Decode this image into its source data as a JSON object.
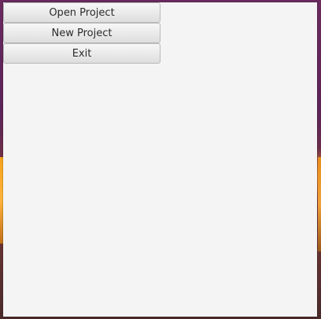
{
  "menu": {
    "buttons": [
      {
        "label": "Open Project"
      },
      {
        "label": "New Project"
      },
      {
        "label": "Exit"
      }
    ]
  },
  "colors": {
    "window_background": "#f4f4f4",
    "button_border": "#b9b9b9",
    "button_text": "#2b2b2b"
  }
}
